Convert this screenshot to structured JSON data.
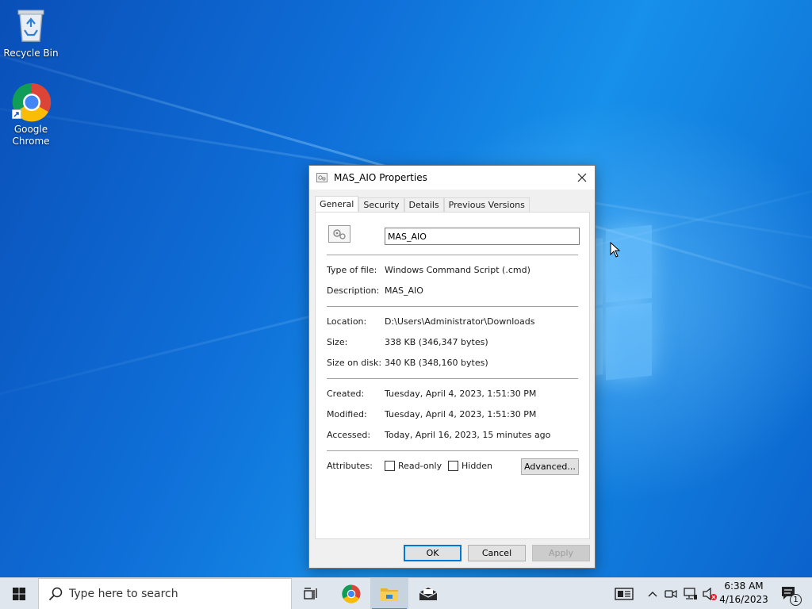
{
  "desktop": {
    "icons": [
      {
        "label": "Recycle Bin"
      },
      {
        "label": "Google Chrome"
      }
    ]
  },
  "dialog": {
    "title": "MAS_AIO Properties",
    "tabs": [
      "General",
      "Security",
      "Details",
      "Previous Versions"
    ],
    "active_tab": "General",
    "file_name": "MAS_AIO",
    "fields": {
      "type_label": "Type of file:",
      "type_value": "Windows Command Script (.cmd)",
      "description_label": "Description:",
      "description_value": "MAS_AIO",
      "location_label": "Location:",
      "location_value": "D:\\Users\\Administrator\\Downloads",
      "size_label": "Size:",
      "size_value": "338 KB (346,347 bytes)",
      "size_on_disk_label": "Size on disk:",
      "size_on_disk_value": "340 KB (348,160 bytes)",
      "created_label": "Created:",
      "created_value": "Tuesday, April 4, 2023, 1:51:30 PM",
      "modified_label": "Modified:",
      "modified_value": "Tuesday, April 4, 2023, 1:51:30 PM",
      "accessed_label": "Accessed:",
      "accessed_value": "Today, April 16, 2023, 15 minutes ago",
      "attributes_label": "Attributes:"
    },
    "attributes": {
      "readonly_label": "Read-only",
      "readonly_checked": false,
      "hidden_label": "Hidden",
      "hidden_checked": false,
      "advanced_label": "Advanced..."
    },
    "buttons": {
      "ok": "OK",
      "cancel": "Cancel",
      "apply": "Apply"
    }
  },
  "taskbar": {
    "search_placeholder": "Type here to search",
    "time": "6:38 AM",
    "date": "4/16/2023",
    "notification_count": "1",
    "accent_color": "#0078d7"
  }
}
